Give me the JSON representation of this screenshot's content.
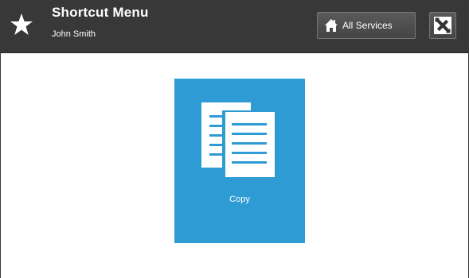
{
  "header": {
    "title": "Shortcut Menu",
    "user": "John Smith",
    "all_services_label": "All Services"
  },
  "tiles": [
    {
      "label": "Copy",
      "icon": "copy-icon",
      "color": "#2e9bd4"
    }
  ],
  "colors": {
    "header_bg": "#383838",
    "tile_bg": "#2e9bd4"
  }
}
